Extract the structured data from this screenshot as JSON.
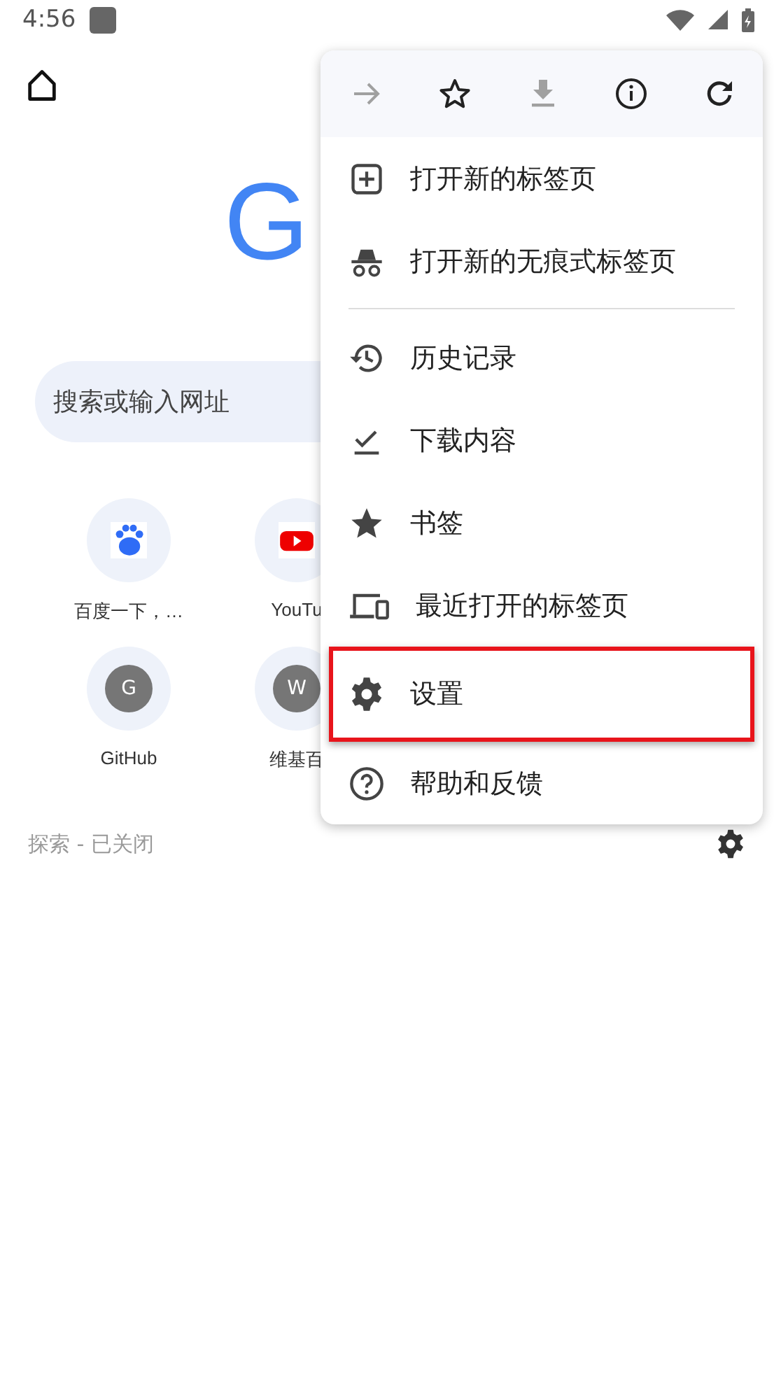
{
  "status_bar": {
    "time": "4:56"
  },
  "logo": {
    "text": "G"
  },
  "search": {
    "placeholder": "搜索或输入网址"
  },
  "tiles": [
    {
      "kind": "baidu",
      "label": "百度一下，…"
    },
    {
      "kind": "youtube",
      "label": "YouTu"
    },
    {
      "kind": "letter",
      "letter": "G",
      "label": "GitHub"
    },
    {
      "kind": "letter",
      "letter": "W",
      "label": "维基百"
    }
  ],
  "discover": {
    "label": "探索 - 已关闭"
  },
  "menu": {
    "toolbar": [
      {
        "kind": "forward",
        "disabled": true
      },
      {
        "kind": "bookmark",
        "disabled": false
      },
      {
        "kind": "download",
        "disabled": true
      },
      {
        "kind": "info",
        "disabled": false
      },
      {
        "kind": "refresh",
        "disabled": false
      }
    ],
    "items": [
      {
        "kind": "new-tab",
        "label": "打开新的标签页",
        "highlighted": false
      },
      {
        "kind": "incognito",
        "label": "打开新的无痕式标签页",
        "highlighted": false,
        "divider_after": true
      },
      {
        "kind": "history",
        "label": "历史记录",
        "highlighted": false
      },
      {
        "kind": "downloads",
        "label": "下载内容",
        "highlighted": false
      },
      {
        "kind": "bookmarks",
        "label": "书签",
        "highlighted": false
      },
      {
        "kind": "recent-tabs",
        "label": "最近打开的标签页",
        "highlighted": false
      },
      {
        "kind": "settings",
        "label": "设置",
        "highlighted": true
      },
      {
        "kind": "help",
        "label": "帮助和反馈",
        "highlighted": false
      }
    ]
  }
}
